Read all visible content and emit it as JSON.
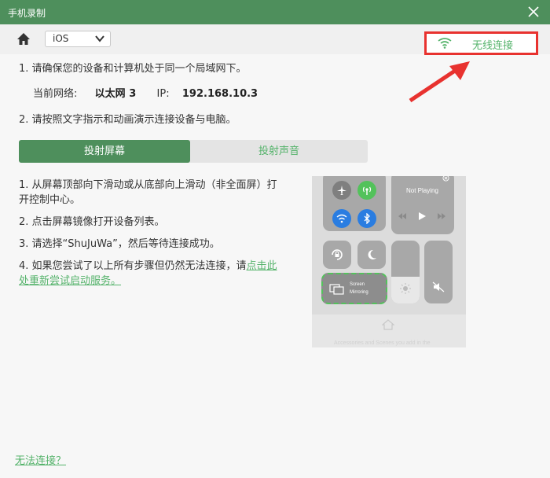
{
  "window": {
    "title": "手机录制",
    "close_icon": "close-icon"
  },
  "toolbar": {
    "home_icon": "home-icon",
    "os_selected": "iOS"
  },
  "wireless": {
    "label": "无线连接",
    "icon": "wifi-icon"
  },
  "steps": {
    "step1": "1. 请确保您的设备和计算机处于同一个局域网下。",
    "network_label": "当前网络:",
    "network_name": "以太网 3",
    "ip_label": "IP:",
    "ip_value": "192.168.10.3",
    "step2": "2. 请按照文字指示和动画演示连接设备与电脑。"
  },
  "tabs": [
    {
      "label": "投射屏幕",
      "active": true
    },
    {
      "label": "投射声音",
      "active": false
    }
  ],
  "instructions": {
    "i1": "1. 从屏幕顶部向下滑动或从底部向上滑动（非全面屏）打开控制中心。",
    "i2": "2. 点击屏幕镜像打开设备列表。",
    "i3": "3. 请选择“ShuJuWa”，然后等待连接成功。",
    "i4_text": "4. 如果您尝试了以上所有步骤但仍然无法连接，请",
    "i4_link": "点击此处重新尝试启动服务。"
  },
  "phone_preview": {
    "now_playing": "Not Playing",
    "screen_mirroring_1": "Screen",
    "screen_mirroring_2": "Mirroring",
    "bottom_text": "Accessories and Scenes you add in the"
  },
  "footer": {
    "cant_connect": "无法连接？"
  },
  "colors": {
    "accent": "#4e8f5c",
    "link": "#55b36b",
    "highlight": "#e8322f"
  }
}
